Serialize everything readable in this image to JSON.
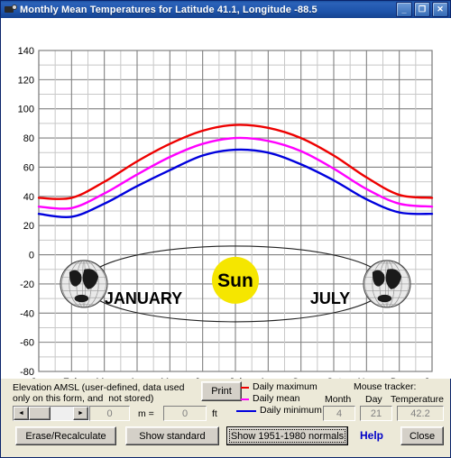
{
  "window": {
    "title": "Monthly Mean Temperatures for Latitude 41.1, Longitude -88.5",
    "icon": "app-chart-icon",
    "minimize": "_",
    "maximize": "❐",
    "close": "✕"
  },
  "chart_data": {
    "type": "line",
    "title": "",
    "xlabel": "",
    "ylabel": "",
    "ylim": [
      -80,
      140
    ],
    "ytick_step": 20,
    "yticks": [
      140,
      120,
      100,
      80,
      60,
      40,
      20,
      0,
      -20,
      -40,
      -60,
      -80
    ],
    "grid": true,
    "minor_grid_step": 10,
    "categories": [
      "Jan",
      "Feb",
      "Mar",
      "Apr",
      "May",
      "Jun",
      "Jul",
      "Aug",
      "Sep",
      "Oct",
      "Nov",
      "Dec",
      "Jan"
    ],
    "legend_position": "below-plot",
    "series": [
      {
        "name": "Daily maximum",
        "color": "#ee0000",
        "values": [
          39,
          39,
          50,
          64,
          76,
          85,
          89,
          87,
          80,
          68,
          53,
          41,
          39
        ]
      },
      {
        "name": "Daily mean",
        "color": "#ff00ff",
        "values": [
          33,
          32,
          42,
          55,
          67,
          76,
          80,
          78,
          71,
          59,
          45,
          35,
          33
        ]
      },
      {
        "name": "Daily minimum",
        "color": "#0000dd",
        "values": [
          28,
          26,
          35,
          47,
          58,
          68,
          72,
          70,
          62,
          51,
          38,
          29,
          28
        ]
      }
    ],
    "annotation": {
      "sun_label": "Sun",
      "left_label": "JANUARY",
      "right_label": "JULY",
      "sun_color": "#f5e600",
      "orbit": "ellipse"
    }
  },
  "elevation": {
    "caption_line1": "Elevation AMSL (user-defined, data used",
    "caption_line2": "only on this form, and  not stored)",
    "scroll_left": "◄",
    "scroll_right": "►",
    "meters_value": "0",
    "equals_label": "m =",
    "feet_value": "0",
    "feet_unit": "ft"
  },
  "print_button": "Print",
  "legend": {
    "maximum": "Daily maximum",
    "mean": "Daily mean",
    "minimum": "Daily minimum",
    "max_color": "#ee0000",
    "mean_color": "#ff00ff",
    "min_color": "#0000dd"
  },
  "mouse_tracker": {
    "title": "Mouse tracker:",
    "month_label": "Month",
    "day_label": "Day",
    "temperature_label": "Temperature",
    "month_value": "4",
    "day_value": "21",
    "temperature_value": "42.2"
  },
  "buttons": {
    "erase": "Erase/Recalculate",
    "show_standard": "Show standard",
    "show_normals": "Show 1951-1980 normals",
    "help": "Help",
    "close": "Close"
  }
}
